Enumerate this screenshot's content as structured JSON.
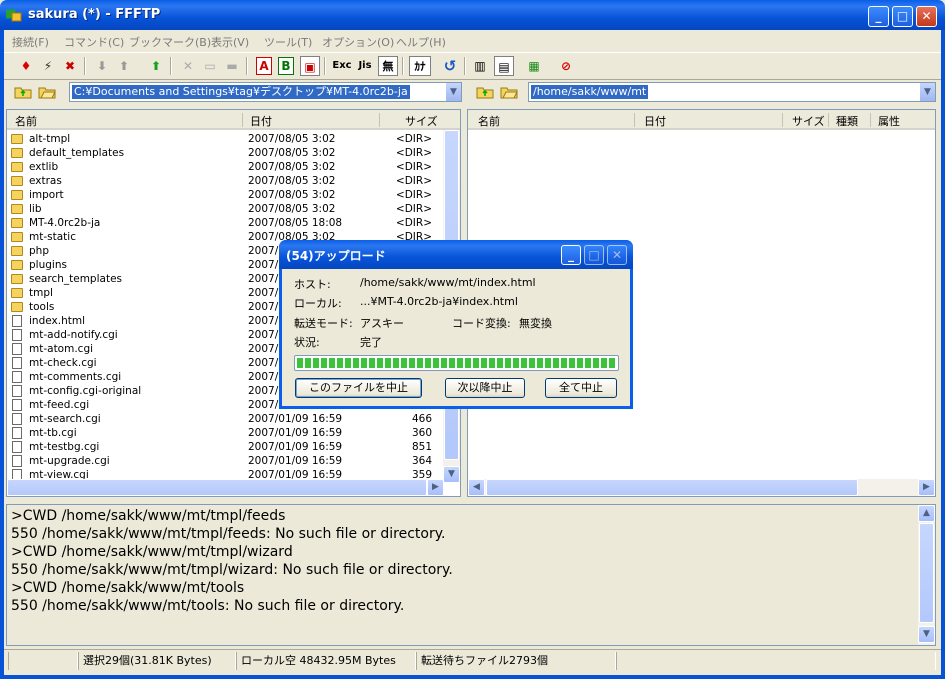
{
  "window": {
    "title": "sakura (*) - FFFTP",
    "min_label": "_",
    "max_label": "□",
    "close_label": "✕"
  },
  "menu": [
    "接続(F)",
    "コマンド(C)",
    "ブックマーク(B)",
    "表示(V)",
    "ツール(T)",
    "オプション(O)",
    "ヘルプ(H)"
  ],
  "toolbar": {
    "labels": {
      "ascii": "A",
      "binary": "B",
      "exec": "Exc",
      "jis": "Jis",
      "nochange": "無",
      "kana": "ｶﾅ"
    }
  },
  "local": {
    "path": "C:¥Documents and Settings¥tag¥デスクトップ¥MT-4.0rc2b-ja",
    "headers": {
      "name": "名前",
      "date": "日付",
      "size": "サイズ"
    },
    "files": [
      {
        "type": "folder",
        "name": "alt-tmpl",
        "date": "2007/08/05  3:02",
        "size": "<DIR>"
      },
      {
        "type": "folder",
        "name": "default_templates",
        "date": "2007/08/05  3:02",
        "size": "<DIR>"
      },
      {
        "type": "folder",
        "name": "extlib",
        "date": "2007/08/05  3:02",
        "size": "<DIR>"
      },
      {
        "type": "folder",
        "name": "extras",
        "date": "2007/08/05  3:02",
        "size": "<DIR>"
      },
      {
        "type": "folder",
        "name": "import",
        "date": "2007/08/05  3:02",
        "size": "<DIR>"
      },
      {
        "type": "folder",
        "name": "lib",
        "date": "2007/08/05  3:02",
        "size": "<DIR>"
      },
      {
        "type": "folder",
        "name": "MT-4.0rc2b-ja",
        "date": "2007/08/05 18:08",
        "size": "<DIR>"
      },
      {
        "type": "folder",
        "name": "mt-static",
        "date": "2007/08/05  3:02",
        "size": "<DIR>"
      },
      {
        "type": "folder",
        "name": "php",
        "date": "2007/",
        "size": ""
      },
      {
        "type": "folder",
        "name": "plugins",
        "date": "2007/",
        "size": ""
      },
      {
        "type": "folder",
        "name": "search_templates",
        "date": "2007/",
        "size": ""
      },
      {
        "type": "folder",
        "name": "tmpl",
        "date": "2007/",
        "size": ""
      },
      {
        "type": "folder",
        "name": "tools",
        "date": "2007/",
        "size": ""
      },
      {
        "type": "file",
        "name": "index.html",
        "date": "2007/",
        "size": ""
      },
      {
        "type": "file",
        "name": "mt-add-notify.cgi",
        "date": "2007/",
        "size": ""
      },
      {
        "type": "file",
        "name": "mt-atom.cgi",
        "date": "2007/",
        "size": ""
      },
      {
        "type": "file",
        "name": "mt-check.cgi",
        "date": "2007/",
        "size": ""
      },
      {
        "type": "file",
        "name": "mt-comments.cgi",
        "date": "2007/",
        "size": ""
      },
      {
        "type": "file",
        "name": "mt-config.cgi-original",
        "date": "2007/",
        "size": ""
      },
      {
        "type": "file",
        "name": "mt-feed.cgi",
        "date": "2007/",
        "size": ""
      },
      {
        "type": "file",
        "name": "mt-search.cgi",
        "date": "2007/01/09 16:59",
        "size": "466"
      },
      {
        "type": "file",
        "name": "mt-tb.cgi",
        "date": "2007/01/09 16:59",
        "size": "360"
      },
      {
        "type": "file",
        "name": "mt-testbg.cgi",
        "date": "2007/01/09 16:59",
        "size": "851"
      },
      {
        "type": "file",
        "name": "mt-upgrade.cgi",
        "date": "2007/01/09 16:59",
        "size": "364"
      },
      {
        "type": "file",
        "name": "mt-view.cgi",
        "date": "2007/01/09 16:59",
        "size": "359"
      }
    ]
  },
  "remote": {
    "path": "/home/sakk/www/mt",
    "headers": {
      "name": "名前",
      "date": "日付",
      "size": "サイズ",
      "type": "種類",
      "attr": "属性"
    }
  },
  "log": [
    ">CWD /home/sakk/www/mt/tmpl/feeds",
    "550 /home/sakk/www/mt/tmpl/feeds: No such file or directory.",
    ">CWD /home/sakk/www/mt/tmpl/wizard",
    "550 /home/sakk/www/mt/tmpl/wizard: No such file or directory.",
    ">CWD /home/sakk/www/mt/tools",
    "550 /home/sakk/www/mt/tools: No such file or directory."
  ],
  "status": {
    "selected": "選択29個(31.81K Bytes)",
    "local_free": "ローカル空 48432.95M Bytes",
    "queue": "転送待ちファイル2793個"
  },
  "dialog": {
    "title": "(54)アップロード",
    "host_label": "ホスト:",
    "host_value": "/home/sakk/www/mt/index.html",
    "local_label": "ローカル:",
    "local_value": "...¥MT-4.0rc2b-ja¥index.html",
    "mode_label": "転送モード:",
    "mode_value": "アスキー",
    "code_label": "コード変換:",
    "code_value": "無変換",
    "state_label": "状況:",
    "state_value": "完了",
    "progress": 1.0,
    "buttons": {
      "stop_file": "このファイルを中止",
      "stop_next": "次以降中止",
      "stop_all": "全て中止"
    }
  }
}
